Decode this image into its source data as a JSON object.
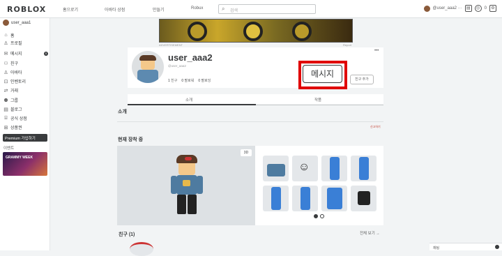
{
  "topbar": {
    "logo": "ROBLOX",
    "nav": [
      "홈으로기",
      "아바타 상점",
      "만들기",
      "Robux"
    ],
    "search_placeholder": "검색",
    "username_short": "@user_aaa2 ···",
    "robux": "0"
  },
  "sidebar": {
    "user": "user_aaa1",
    "items": [
      {
        "icon": "home-icon",
        "label": "홈"
      },
      {
        "icon": "profile-icon",
        "label": "프로필"
      },
      {
        "icon": "message-icon",
        "label": "메시지"
      },
      {
        "icon": "friends-icon",
        "label": "친구"
      },
      {
        "icon": "avatar-icon",
        "label": "아바타"
      },
      {
        "icon": "inventory-icon",
        "label": "인벤토리"
      },
      {
        "icon": "trade-icon",
        "label": "거래"
      },
      {
        "icon": "groups-icon",
        "label": "그룹"
      },
      {
        "icon": "blog-icon",
        "label": "블로그"
      },
      {
        "icon": "store-icon",
        "label": "공식 상점"
      },
      {
        "icon": "gift-icon",
        "label": "상품권"
      }
    ],
    "message_badge": "0",
    "premium": "Premium 가입하기",
    "events_label": "이벤트",
    "event_banner": "GRAMMY WEEK"
  },
  "ad": {
    "label": "ADVERTISEMENT",
    "report": "Report"
  },
  "profile": {
    "name": "user_aaa2",
    "handle": "@user_aaa2",
    "stats": [
      {
        "value": "1",
        "label": "친구"
      },
      {
        "value": "0",
        "label": "팔로워"
      },
      {
        "value": "0",
        "label": "팔로잉"
      }
    ],
    "message_button": "메시지",
    "add_friend_button": "친구 추가",
    "more": "•••"
  },
  "tabs": [
    "소개",
    "작품"
  ],
  "about": {
    "heading": "소개",
    "report": "신고하기"
  },
  "wearing": {
    "heading": "현재 장착 중",
    "button_3d": "3D"
  },
  "friends": {
    "heading": "친구 (1)",
    "see_all": "전체 보기 →"
  },
  "chat": {
    "label": "채팅"
  }
}
